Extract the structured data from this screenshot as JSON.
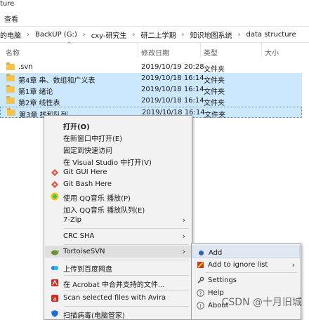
{
  "window": {
    "title_partial": "ture",
    "ribbon_tab": "查看"
  },
  "address_bar": {
    "crumbs": [
      "的电脑",
      "BackUP (G:)",
      "cxy-研究生",
      "研二上学期",
      "知识地图系统",
      "data structure"
    ]
  },
  "columns": {
    "name": "名称",
    "modified": "修改日期",
    "type": "类型",
    "size": "大小"
  },
  "files": [
    {
      "name": ".svn",
      "modified": "2019/10/19 20:28",
      "type": "文件夹",
      "selected": false
    },
    {
      "name": "第4章 串、数组和广义表",
      "modified": "2019/10/18 16:14",
      "type": "文件夹",
      "selected": true
    },
    {
      "name": "第1章 绪论",
      "modified": "2019/10/18 16:14",
      "type": "文件夹",
      "selected": true
    },
    {
      "name": "第2章 线性表",
      "modified": "2019/10/18 16:14",
      "type": "文件夹",
      "selected": true
    },
    {
      "name": "第3章 栈和队列",
      "modified": "2019/10/18 16:14",
      "type": "文件夹",
      "selected": true
    }
  ],
  "context_menu": {
    "open": "打开(O)",
    "open_new_window": "在新窗口中打开(E)",
    "pin_quick_access": "固定到快速访问",
    "open_visual_studio": "在 Visual Studio 中打开(V)",
    "git_gui": "Git GUI Here",
    "git_bash": "Git Bash Here",
    "qq_play": "使用 QQ音乐 播放(P)",
    "qq_queue": "加入 QQ音乐 播放队列(E)",
    "zip": "7-Zip",
    "crc": "CRC SHA",
    "tortoise": "TortoiseSVN",
    "baidu": "上传到百度网盘",
    "acrobat": "在 Acrobat 中合并支持的文件...",
    "avira": "Scan selected files with Avira",
    "virus": "扫描病毒(电脑管家)"
  },
  "submenu": {
    "add": "Add",
    "ignore": "Add to ignore list",
    "settings": "Settings",
    "help": "Help",
    "about": "About"
  },
  "watermark": "CSDN @十月旧城",
  "colors": {
    "selection": "#cce8ff",
    "folder": "#f3c44f",
    "menu_bg": "#f2f2f2"
  }
}
